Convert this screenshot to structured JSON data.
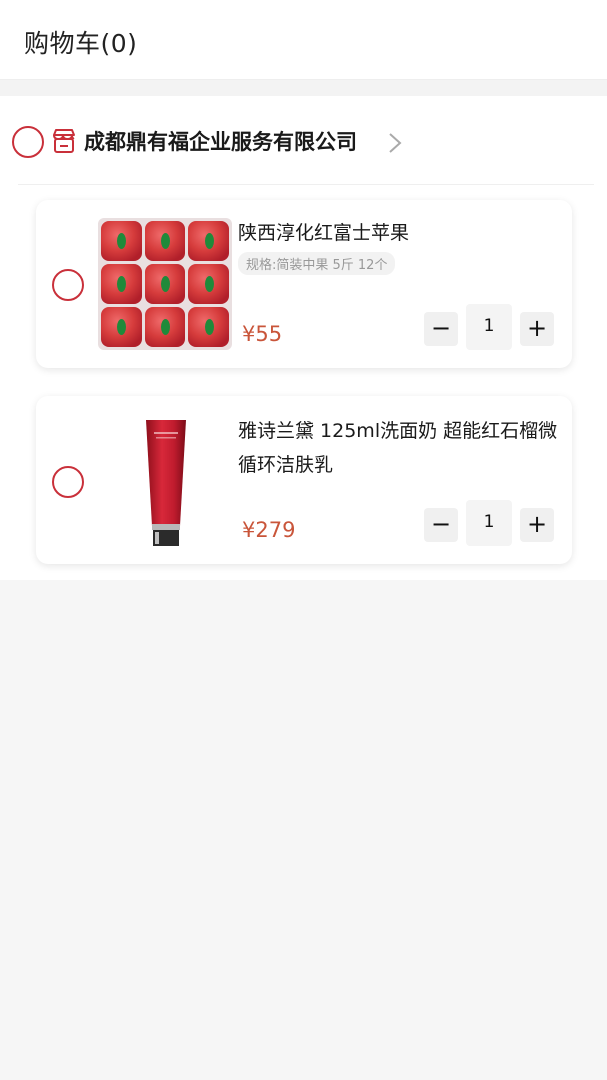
{
  "header": {
    "title": "购物车(0)"
  },
  "store": {
    "name": "成都鼎有福企业服务有限公司"
  },
  "items": [
    {
      "title": "陕西淳化红富士苹果",
      "spec": "规格:简装中果 5斤 12个",
      "price": "¥55",
      "quantity": "1",
      "minus_label": "−",
      "plus_label": "+"
    },
    {
      "title": "雅诗兰黛 125ml洗面奶 超能红石榴微循环洁肤乳",
      "price": "¥279",
      "quantity": "1",
      "minus_label": "−",
      "plus_label": "+"
    }
  ],
  "colors": {
    "accent": "#c9303a",
    "price": "#c9553a",
    "background": "#f6f6f6"
  }
}
